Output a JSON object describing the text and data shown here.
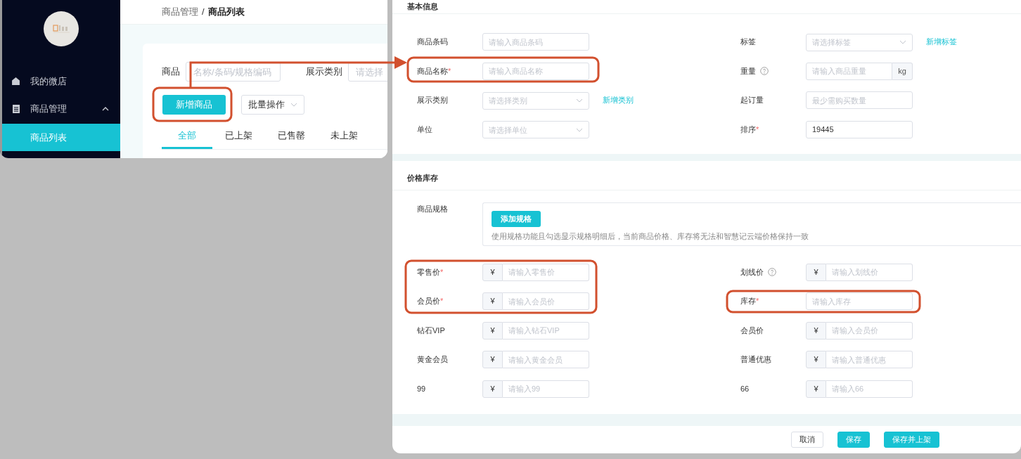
{
  "product_list_window": {
    "sidebar": {
      "items": [
        {
          "label": "我的微店",
          "selected": false
        },
        {
          "label": "商品管理",
          "expanded": true,
          "selected": false,
          "children": [
            {
              "label": "商品列表",
              "selected": true
            }
          ]
        }
      ]
    },
    "breadcrumb": {
      "parent": "商品管理",
      "separator": "/",
      "current": "商品列表"
    },
    "filters": [
      {
        "label": "商品",
        "placeholder": "名称/条码/规格编码"
      },
      {
        "label": "展示类别",
        "placeholder": "请选择"
      }
    ],
    "add_button": "新增商品",
    "batch_dropdown": "批量操作",
    "tabs": [
      {
        "label": "全部",
        "selected": true
      },
      {
        "label": "已上架",
        "selected": false
      },
      {
        "label": "已售罄",
        "selected": false
      },
      {
        "label": "未上架",
        "selected": false
      }
    ]
  },
  "product_form_window": {
    "sections": [
      {
        "title": "基本信息",
        "fields": [
          {
            "label": "商品条码",
            "kind": "input",
            "help": false,
            "placeholder": "请输入商品条码"
          },
          {
            "label": "标签",
            "kind": "select",
            "help": false,
            "placeholder": "请选择标签",
            "link": "新增标签"
          },
          {
            "label": "商品名称",
            "required_mark": "*",
            "kind": "input",
            "help": false,
            "placeholder": "请输入商品名称"
          },
          {
            "label": "重量",
            "kind": "unit",
            "help": true,
            "placeholder": "请输入商品重量",
            "unit": "kg"
          },
          {
            "label": "展示类别",
            "kind": "select",
            "help": false,
            "placeholder": "请选择类别",
            "link": "新增类别"
          },
          {
            "label": "起订量",
            "kind": "input",
            "help": false,
            "placeholder": "最少需购买数量"
          },
          {
            "label": "单位",
            "kind": "select",
            "help": false,
            "placeholder": "请选择单位"
          },
          {
            "label": "排序",
            "required_mark": "*",
            "kind": "input",
            "help": false,
            "value": "19445"
          }
        ]
      },
      {
        "title": "价格库存",
        "spec": {
          "label": "商品规格",
          "button": "添加规格",
          "note": "使用规格功能且勾选显示规格明细后，当前商品价格、库存将无法和智慧记云端价格保持一致"
        },
        "fields": [
          {
            "label": "零售价",
            "required_mark": "*",
            "kind": "price",
            "help": false,
            "prefix": "¥",
            "placeholder": "请输入零售价"
          },
          {
            "label": "划线价",
            "kind": "price",
            "help": true,
            "prefix": "¥",
            "placeholder": "请输入划线价"
          },
          {
            "label": "会员价",
            "required_mark": "*",
            "kind": "price",
            "help": false,
            "prefix": "¥",
            "placeholder": "请输入会员价"
          },
          {
            "label": "库存",
            "required_mark": "*",
            "kind": "input",
            "help": false,
            "placeholder": "请输入库存"
          },
          {
            "label": "钻石VIP",
            "kind": "price",
            "help": false,
            "prefix": "¥",
            "placeholder": "请输入钻石VIP"
          },
          {
            "label": "会员价",
            "kind": "price",
            "help": false,
            "prefix": "¥",
            "placeholder": "请输入会员价"
          },
          {
            "label": "黄金会员",
            "kind": "price",
            "help": false,
            "prefix": "¥",
            "placeholder": "请输入黄金会员"
          },
          {
            "label": "普通优惠",
            "kind": "price",
            "help": false,
            "prefix": "¥",
            "placeholder": "请输入普通优惠"
          },
          {
            "label": "99",
            "kind": "price",
            "help": false,
            "prefix": "¥",
            "placeholder": "请输入99"
          },
          {
            "label": "66",
            "kind": "price",
            "help": false,
            "prefix": "¥",
            "placeholder": "请输入66"
          }
        ]
      }
    ],
    "footer_buttons": [
      {
        "label": "取消",
        "kind": "default"
      },
      {
        "label": "保存",
        "kind": "primary"
      },
      {
        "label": "保存并上架",
        "kind": "primary"
      }
    ]
  }
}
